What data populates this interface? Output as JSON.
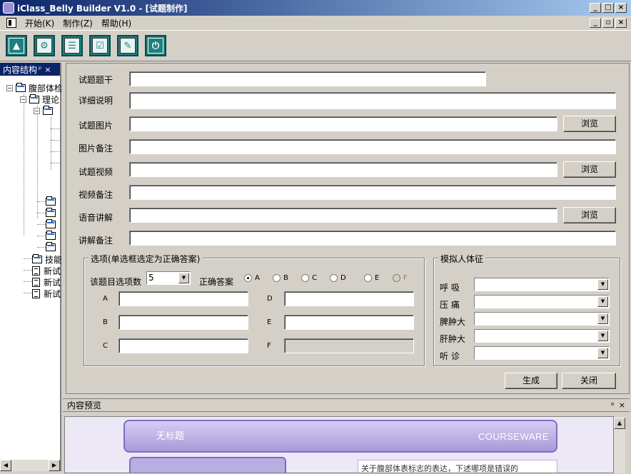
{
  "window": {
    "title": "iClass_Belly Builder V1.0  - [试题制作]",
    "min": "_",
    "max": "□",
    "close": "×",
    "restore": "▫"
  },
  "menu": {
    "items": [
      "开始(K)",
      "制作(Z)",
      "帮助(H)"
    ]
  },
  "toolbar": {
    "icons": [
      "navigate-icon",
      "gear-icon",
      "form-icon",
      "checklist-icon",
      "tools-icon",
      "exit-icon"
    ]
  },
  "left_pane": {
    "title": "内容结构",
    "pin": "ᵖ",
    "close": "×",
    "tree": [
      {
        "label": "腹部体检",
        "level": 0
      },
      {
        "label": "理论",
        "level": 1
      },
      {
        "label": "技能",
        "level": 1
      },
      {
        "label": "新试题",
        "level": 1
      },
      {
        "label": "新试题",
        "level": 1
      },
      {
        "label": "新试题",
        "level": 1
      }
    ]
  },
  "form": {
    "labels": {
      "stem": "试题题干",
      "detail": "详细说明",
      "image": "试题图片",
      "image_note": "图片备注",
      "video": "试题视频",
      "video_note": "视频备注",
      "audio": "语音讲解",
      "audio_note": "讲解备注"
    },
    "browse": "浏览",
    "options_group": {
      "title": "选项(单选框选定为正确答案)",
      "count_label": "该题目选项数",
      "count_value": "5",
      "answer_label": "正确答案",
      "radios": [
        "A",
        "B",
        "C",
        "D",
        "E",
        "F"
      ],
      "selected": "A",
      "letters": [
        "A",
        "B",
        "C",
        "D",
        "E",
        "F"
      ]
    },
    "sim_group": {
      "title": "模拟人体征",
      "rows": [
        "呼  吸",
        "压  痛",
        "脾肿大",
        "肝肿大",
        "听  诊"
      ]
    },
    "generate": "生成",
    "close": "关闭"
  },
  "preview": {
    "title": "内容预览",
    "pin": "ᵖ",
    "close": "×",
    "card_title": "无标题",
    "brand": "COURSEWARE",
    "snippet": "关于腹部体表标志的表达，下述哪项是错误的"
  }
}
